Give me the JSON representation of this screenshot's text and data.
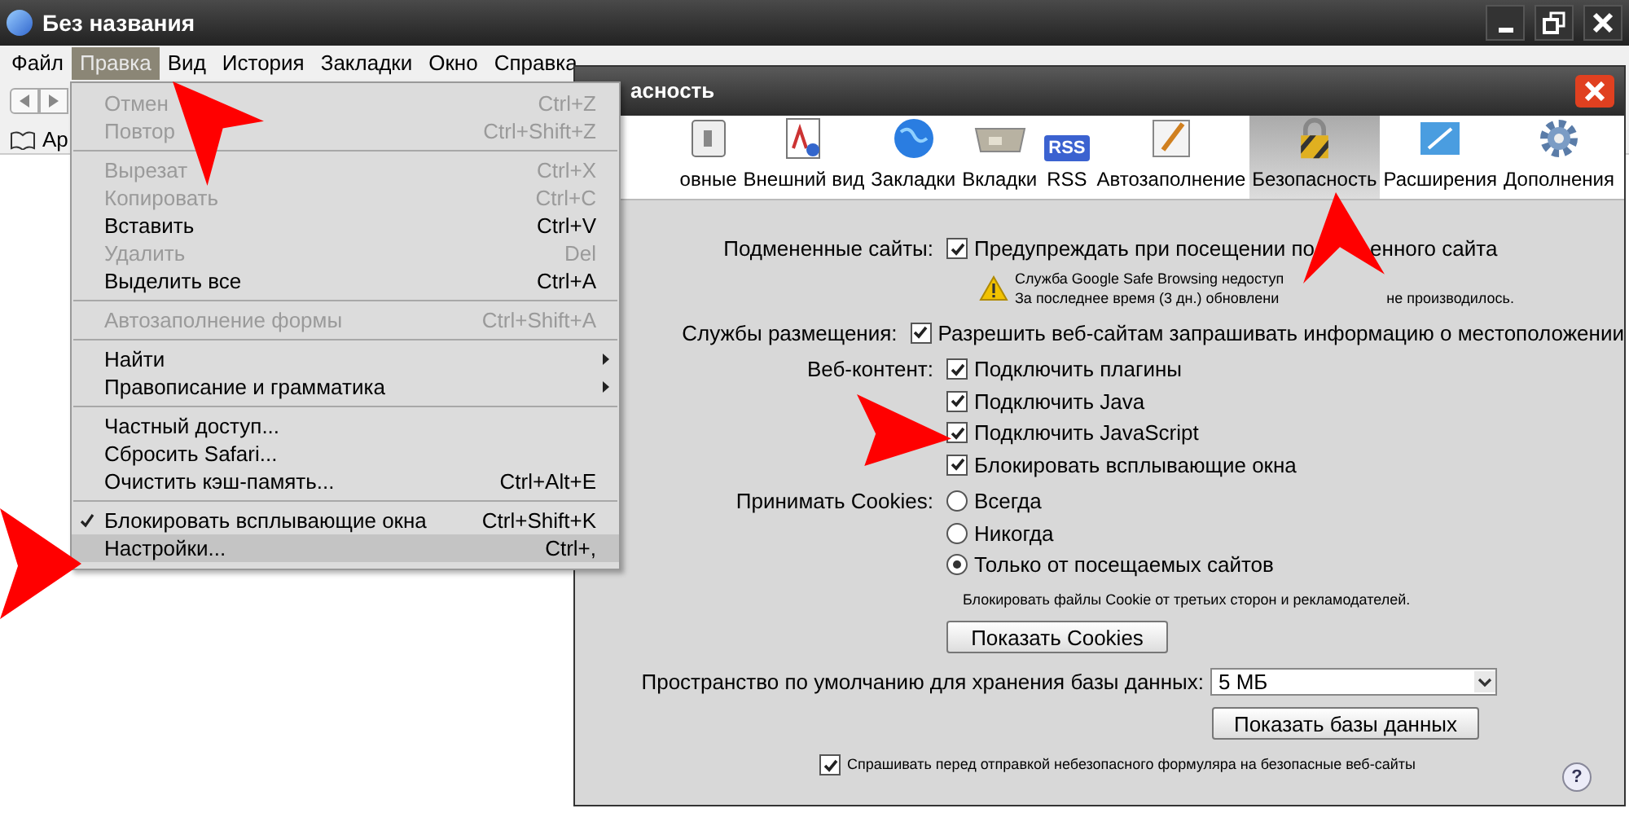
{
  "window": {
    "title": "Без названия"
  },
  "menubar": [
    {
      "label": "Файл",
      "selected": false
    },
    {
      "label": "Правка",
      "selected": true
    },
    {
      "label": "Вид",
      "selected": false
    },
    {
      "label": "История",
      "selected": false
    },
    {
      "label": "Закладки",
      "selected": false
    },
    {
      "label": "Окно",
      "selected": false
    },
    {
      "label": "Справка",
      "selected": false
    }
  ],
  "bookmarks_bar": {
    "label": "Ар"
  },
  "edit_menu": [
    {
      "kind": "item",
      "label": "Отмен",
      "shortcut": "Ctrl+Z",
      "disabled": true,
      "checked": false,
      "selected": false,
      "submenu": false
    },
    {
      "kind": "item",
      "label": "Повтор",
      "shortcut": "Ctrl+Shift+Z",
      "disabled": true,
      "checked": false,
      "selected": false,
      "submenu": false
    },
    {
      "kind": "separator"
    },
    {
      "kind": "item",
      "label": "Вырезат",
      "shortcut": "Ctrl+X",
      "disabled": true,
      "checked": false,
      "selected": false,
      "submenu": false
    },
    {
      "kind": "item",
      "label": "Копировать",
      "shortcut": "Ctrl+C",
      "disabled": true,
      "checked": false,
      "selected": false,
      "submenu": false
    },
    {
      "kind": "item",
      "label": "Вставить",
      "shortcut": "Ctrl+V",
      "disabled": false,
      "checked": false,
      "selected": false,
      "submenu": false
    },
    {
      "kind": "item",
      "label": "Удалить",
      "shortcut": "Del",
      "disabled": true,
      "checked": false,
      "selected": false,
      "submenu": false
    },
    {
      "kind": "item",
      "label": "Выделить все",
      "shortcut": "Ctrl+A",
      "disabled": false,
      "checked": false,
      "selected": false,
      "submenu": false
    },
    {
      "kind": "separator"
    },
    {
      "kind": "item",
      "label": "Автозаполнение формы",
      "shortcut": "Ctrl+Shift+A",
      "disabled": true,
      "checked": false,
      "selected": false,
      "submenu": false
    },
    {
      "kind": "separator"
    },
    {
      "kind": "item",
      "label": "Найти",
      "disabled": false,
      "checked": false,
      "selected": false,
      "submenu": true
    },
    {
      "kind": "item",
      "label": "Правописание и грамматика",
      "disabled": false,
      "checked": false,
      "selected": false,
      "submenu": true
    },
    {
      "kind": "separator"
    },
    {
      "kind": "item",
      "label": "Частный доступ...",
      "disabled": false,
      "checked": false,
      "selected": false,
      "submenu": false
    },
    {
      "kind": "item",
      "label": "Сбросить Safari...",
      "disabled": false,
      "checked": false,
      "selected": false,
      "submenu": false
    },
    {
      "kind": "item",
      "label": "Очистить кэш-память...",
      "shortcut": "Ctrl+Alt+E",
      "disabled": false,
      "checked": false,
      "selected": false,
      "submenu": false
    },
    {
      "kind": "separator"
    },
    {
      "kind": "item",
      "label": "Блокировать всплывающие окна",
      "shortcut": "Ctrl+Shift+K",
      "disabled": false,
      "checked": true,
      "selected": false,
      "submenu": false
    },
    {
      "kind": "item",
      "label": "Настройки...",
      "shortcut": "Ctrl+,",
      "disabled": false,
      "checked": false,
      "selected": true,
      "submenu": false
    }
  ],
  "dialog": {
    "title": "асность",
    "tabs": [
      {
        "label": "овные",
        "selected": false
      },
      {
        "label": "Внешний вид",
        "selected": false
      },
      {
        "label": "Закладки",
        "selected": false
      },
      {
        "label": "Вкладки",
        "selected": false
      },
      {
        "badge": "RSS",
        "label": "RSS",
        "selected": false
      },
      {
        "label": "Автозаполнение",
        "selected": false
      },
      {
        "label": "Безопасность",
        "selected": true
      },
      {
        "label": "Расширения",
        "selected": false
      },
      {
        "label": "Дополнения",
        "selected": false
      }
    ],
    "fraud": {
      "label": "Подмененные сайты:",
      "text_before": "Предупреждать при посещении по",
      "text_after": "енного сайта",
      "checked": true
    },
    "warning": {
      "line1": "Служба Google Safe Browsing недоступ",
      "line2_before": "За последнее время (3 дн.) обновлени",
      "line2_after": "не производилось."
    },
    "location": {
      "label": "Службы размещения:",
      "text": "Разрешить веб-сайтам запрашивать информацию о местоположении",
      "checked": true
    },
    "web_content": {
      "label": "Веб-контент:",
      "options": [
        {
          "text": "Подключить плагины",
          "checked": true
        },
        {
          "text": "Подключить Java",
          "checked": true
        },
        {
          "text": "Подключить JavaScript",
          "checked": true
        },
        {
          "text": "Блокировать всплывающие окна",
          "checked": true
        }
      ]
    },
    "cookies": {
      "label": "Принимать Cookies:",
      "options": [
        {
          "text": "Всегда",
          "selected": false
        },
        {
          "text": "Никогда",
          "selected": false
        },
        {
          "text": "Только от посещаемых сайтов",
          "selected": true
        }
      ],
      "note": "Блокировать файлы Cookie от третьих сторон и рекламодателей.",
      "button": "Показать Cookies"
    },
    "database": {
      "label": "Пространство по умолчанию для хранения базы данных:",
      "value": "5 МБ",
      "button": "Показать базы данных"
    },
    "ask": {
      "text": "Спрашивать перед отправкой небезопасного формуляра на безопасные веб-сайты",
      "checked": true
    },
    "help": "?"
  }
}
